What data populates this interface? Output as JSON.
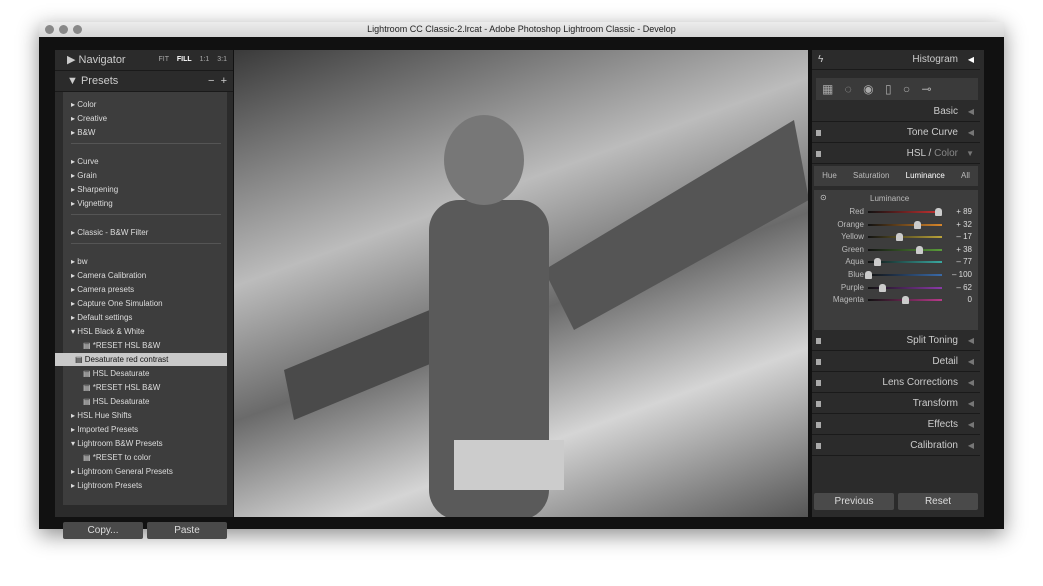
{
  "window": {
    "title": "Lightroom CC Classic-2.lrcat - Adobe Photoshop Lightroom Classic - Develop"
  },
  "navigator": {
    "label": "Navigator",
    "zoom": [
      "FIT",
      "FILL",
      "1:1",
      "3:1"
    ]
  },
  "presets": {
    "label": "Presets",
    "items": [
      {
        "label": "Color",
        "type": "folder"
      },
      {
        "label": "Creative",
        "type": "folder"
      },
      {
        "label": "B&W",
        "type": "folder"
      },
      {
        "sep": true
      },
      {
        "label": "Curve",
        "type": "folder"
      },
      {
        "label": "Grain",
        "type": "folder"
      },
      {
        "label": "Sharpening",
        "type": "folder"
      },
      {
        "label": "Vignetting",
        "type": "folder"
      },
      {
        "sep": true
      },
      {
        "label": "Classic - B&W Filter",
        "type": "folder"
      },
      {
        "sep": true
      },
      {
        "label": "bw",
        "type": "folder"
      },
      {
        "label": "Camera Calibration",
        "type": "folder"
      },
      {
        "label": "Camera presets",
        "type": "folder"
      },
      {
        "label": "Capture One Simulation",
        "type": "folder"
      },
      {
        "label": "Default settings",
        "type": "folder"
      },
      {
        "label": "HSL Black & White",
        "type": "open"
      },
      {
        "label": "*RESET HSL B&W",
        "type": "preset"
      },
      {
        "label": "Desaturate red contrast",
        "type": "preset",
        "selected": true
      },
      {
        "label": "HSL Desaturate",
        "type": "preset"
      },
      {
        "label": "*RESET HSL B&W",
        "type": "preset"
      },
      {
        "label": "HSL Desaturate",
        "type": "preset"
      },
      {
        "label": "HSL Hue Shifts",
        "type": "folder"
      },
      {
        "label": "Imported Presets",
        "type": "folder"
      },
      {
        "label": "Lightroom B&W Presets",
        "type": "open"
      },
      {
        "label": "*RESET to color",
        "type": "preset"
      },
      {
        "label": "Lightroom General Presets",
        "type": "folder"
      },
      {
        "label": "Lightroom Presets",
        "type": "folder"
      }
    ]
  },
  "left_buttons": {
    "copy": "Copy...",
    "paste": "Paste"
  },
  "right": {
    "histogram": "Histogram",
    "basic": "Basic",
    "tone_curve": "Tone Curve",
    "hsl": "HSL",
    "color": "Color",
    "tabs": [
      "Hue",
      "Saturation",
      "Luminance",
      "All"
    ],
    "active_tab": "Luminance",
    "section": "Luminance",
    "sliders": [
      {
        "name": "Red",
        "value": "+ 89",
        "v": 89,
        "color": "#c33"
      },
      {
        "name": "Orange",
        "value": "+ 32",
        "v": 32,
        "color": "#d8862a"
      },
      {
        "name": "Yellow",
        "value": "– 17",
        "v": -17,
        "color": "#bba43a"
      },
      {
        "name": "Green",
        "value": "+ 38",
        "v": 38,
        "color": "#5a9c3a"
      },
      {
        "name": "Aqua",
        "value": "– 77",
        "v": -77,
        "color": "#3aa8a0"
      },
      {
        "name": "Blue",
        "value": "– 100",
        "v": -100,
        "color": "#3a6aa8"
      },
      {
        "name": "Purple",
        "value": "– 62",
        "v": -62,
        "color": "#8a3aa8"
      },
      {
        "name": "Magenta",
        "value": "0",
        "v": 0,
        "color": "#b83a8a"
      }
    ],
    "panels": [
      "Split Toning",
      "Detail",
      "Lens Corrections",
      "Transform",
      "Effects",
      "Calibration"
    ],
    "previous": "Previous",
    "reset": "Reset"
  }
}
